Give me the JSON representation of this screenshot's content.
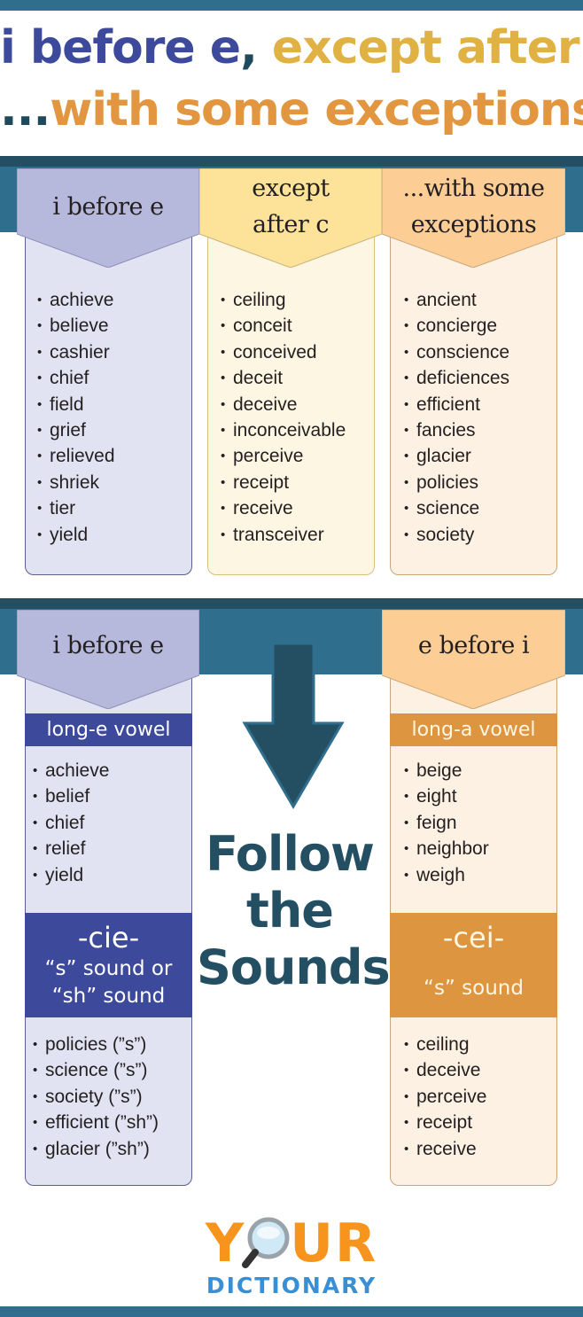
{
  "title": {
    "line1_part1": "i before e",
    "line1_comma": ",",
    "line1_part2": " except after c",
    "line2_dots": "...",
    "line2_text": "with some exceptions"
  },
  "section1": {
    "columns": [
      {
        "header_lines": [
          "i before e"
        ],
        "words": [
          "achieve",
          "believe",
          "cashier",
          "chief",
          "field",
          "grief",
          "relieved",
          "shriek",
          "tier",
          "yield"
        ]
      },
      {
        "header_lines": [
          "except",
          "after c"
        ],
        "words": [
          "ceiling",
          "conceit",
          "conceived",
          "deceit",
          "deceive",
          "inconceivable",
          "perceive",
          "receipt",
          "receive",
          "transceiver"
        ]
      },
      {
        "header_lines": [
          "...with some",
          "exceptions"
        ],
        "words": [
          "ancient",
          "concierge",
          "conscience",
          "deficiences",
          "efficient",
          "fancies",
          "glacier",
          "policies",
          "science",
          "society"
        ]
      }
    ]
  },
  "section2": {
    "left": {
      "header": "i before e",
      "vowel_label": "long-e vowel",
      "vowel_words": [
        "achieve",
        "belief",
        "chief",
        "relief",
        "yield"
      ],
      "pattern": "-cie-",
      "pattern_sound_line1": "“s” sound or",
      "pattern_sound_line2": "“sh” sound",
      "pattern_words": [
        "policies (”s”)",
        "science (”s”)",
        "society (”s”)",
        "efficient (”sh”)",
        "glacier (”sh”)"
      ]
    },
    "center": {
      "arrow_icon": "arrow-down-icon",
      "lines": [
        "Follow",
        "the",
        "Sounds"
      ]
    },
    "right": {
      "header": "e before i",
      "vowel_label": "long-a vowel",
      "vowel_words": [
        "beige",
        "eight",
        "feign",
        "neighbor",
        "weigh"
      ],
      "pattern": "-cei-",
      "pattern_sound": "“s” sound",
      "pattern_words": [
        "ceiling",
        "deceive",
        "perceive",
        "receipt",
        "receive"
      ]
    }
  },
  "logo": {
    "part1": "Y",
    "icon": "magnifier-icon",
    "part2": "UR",
    "subtitle": "DICTIONARY"
  },
  "colors": {
    "band": "#2f6e8d",
    "purple_header": "#b6b8dc",
    "yellow_header": "#fde29a",
    "peach_header": "#fcce96",
    "blue_strip": "#3d4a9c",
    "orange_strip": "#dd9540",
    "arrow": "#244f62"
  }
}
